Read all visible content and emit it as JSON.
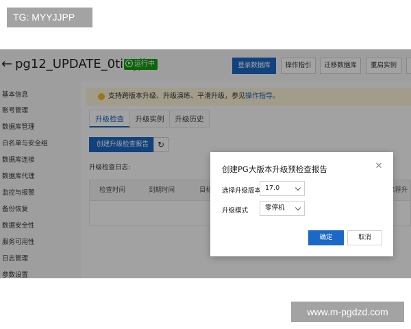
{
  "watermarks": {
    "top": "TG: MYYJJPP",
    "bottom": "www.m-pgdzd.com"
  },
  "header": {
    "title": "pg12_UPDATE_0tingji",
    "status": "运行中",
    "buttons": [
      "登录数据库",
      "操作指引",
      "迁移数据库",
      "重启实例"
    ]
  },
  "sidebar": {
    "items": [
      "基本信息",
      "账号管理",
      "数据库管理",
      "白名单与安全组",
      "数据库连接",
      "数据库代理",
      "监控与报警",
      "备份恢复",
      "数据安全性",
      "服务可用性",
      "日志管理",
      "参数设置"
    ]
  },
  "notice": {
    "text": "支持跨版本升级、升级演练、平滑升级，参见",
    "link": "操作指导。"
  },
  "tabs": [
    "升级检查",
    "升级实例",
    "升级历史"
  ],
  "toolbar": {
    "create_label": "创建升级检查报告"
  },
  "log_label": "升级检查日志:",
  "table": {
    "columns": [
      "检查时间",
      "到期时间",
      "目标",
      "推荐升"
    ]
  },
  "modal": {
    "title": "创建PG大版本升级预检查报告",
    "fields": [
      {
        "label": "选择升级版本:",
        "value": "17.0"
      },
      {
        "label": "升级模式",
        "value": "零停机"
      }
    ],
    "ok_label": "确定",
    "cancel_label": "取消"
  },
  "colors": {
    "primary": "#1b68c6",
    "status_green": "#12a012",
    "notice_bg": "#fdf4da",
    "warn": "#f5b82d"
  },
  "icons": {
    "back": "back-arrow-icon",
    "refresh": "refresh-icon",
    "close": "close-icon",
    "play": "play-circle-icon"
  }
}
